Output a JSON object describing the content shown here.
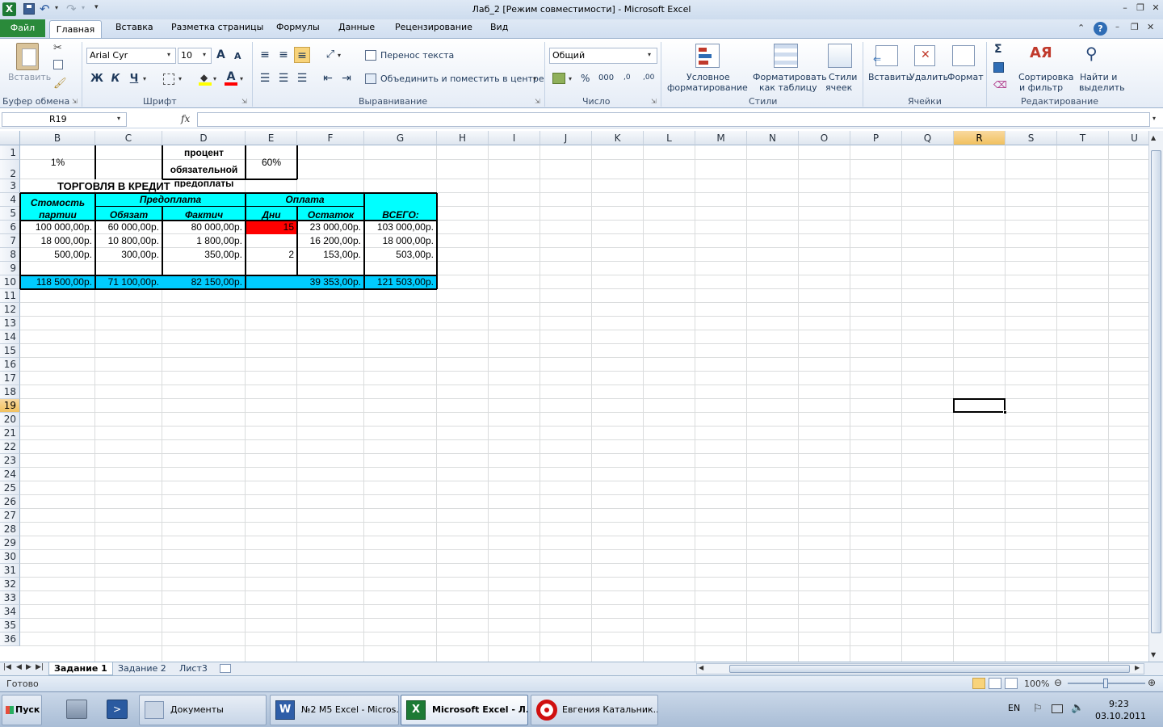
{
  "window": {
    "title": "Лаб_2  [Режим совместимости]  -  Microsoft Excel"
  },
  "quick_access": {
    "save_icon": "save-icon",
    "undo_icon": "undo-icon",
    "redo_icon": "redo-icon"
  },
  "tabs": [
    {
      "label": "Файл"
    },
    {
      "label": "Главная"
    },
    {
      "label": "Вставка"
    },
    {
      "label": "Разметка страницы"
    },
    {
      "label": "Формулы"
    },
    {
      "label": "Данные"
    },
    {
      "label": "Рецензирование"
    },
    {
      "label": "Вид"
    }
  ],
  "ribbon": {
    "clipboard": {
      "name": "Буфер обмена",
      "paste": "Вставить"
    },
    "font": {
      "name": "Шрифт",
      "family": "Arial Cyr",
      "size": "10",
      "bold": "Ж",
      "italic": "К",
      "underline": "Ч",
      "grow": "A",
      "shrink": "A",
      "color_letter": "A"
    },
    "alignment": {
      "name": "Выравнивание",
      "wrap": "Перенос текста",
      "merge": "Объединить и поместить в центре"
    },
    "number": {
      "name": "Число",
      "format": "Общий",
      "percent": "%",
      "thousands": "000",
      "inc_dec": ",0",
      "dec_dec": ",00"
    },
    "styles": {
      "name": "Стили",
      "conditional_1": "Условное",
      "conditional_2": "форматирование",
      "table_1": "Форматировать",
      "table_2": "как таблицу",
      "cell_1": "Стили",
      "cell_2": "ячеек"
    },
    "cells": {
      "name": "Ячейки",
      "insert": "Вставить",
      "delete": "Удалить",
      "format": "Формат"
    },
    "editing": {
      "name": "Редактирование",
      "sort_1": "Сортировка",
      "sort_2": "и фильтр",
      "find_1": "Найти и",
      "find_2": "выделить",
      "sigma": "Σ"
    }
  },
  "formula_bar": {
    "name_box": "R19",
    "fx": "fx",
    "content": ""
  },
  "columns": [
    "B",
    "C",
    "D",
    "E",
    "F",
    "G",
    "H",
    "I",
    "J",
    "K",
    "L",
    "M",
    "N",
    "O",
    "P",
    "Q",
    "R",
    "S",
    "T",
    "U"
  ],
  "rows": [
    "1",
    "2",
    "3",
    "4",
    "5",
    "6",
    "7",
    "8",
    "9",
    "10",
    "11",
    "12",
    "13",
    "14",
    "15",
    "16",
    "17",
    "18",
    "19",
    "20",
    "21",
    "22",
    "23",
    "24",
    "25",
    "26",
    "27",
    "28",
    "29",
    "30",
    "31",
    "32",
    "33",
    "34",
    "35",
    "36"
  ],
  "selected": {
    "column": "R",
    "row": "19"
  },
  "sheet": {
    "b2": "1%",
    "d1": "процент",
    "d1b": "обязательной",
    "d2": "предоплаты",
    "e2": "60%",
    "title": "ТОРГОВЛЯ В КРЕДИТ",
    "hdr_cost_1": "Стомость",
    "hdr_cost_2": "партии",
    "hdr_prepay": "Предоплата",
    "hdr_oblig": "Обязат",
    "hdr_fact": "Фактич",
    "hdr_payment": "Оплата",
    "hdr_days": "Дни",
    "hdr_rest": "Остаток",
    "hdr_total": "ВСЕГО:",
    "data": [
      {
        "b": "100 000,00р.",
        "c": "60 000,00р.",
        "d": "80 000,00р.",
        "e": "15",
        "f": "23 000,00р.",
        "g": "103 000,00р."
      },
      {
        "b": "18 000,00р.",
        "c": "10 800,00р.",
        "d": "1 800,00р.",
        "e": "",
        "f": "16 200,00р.",
        "g": "18 000,00р."
      },
      {
        "b": "500,00р.",
        "c": "300,00р.",
        "d": "350,00р.",
        "e": "2",
        "f": "153,00р.",
        "g": "503,00р."
      }
    ],
    "totals": {
      "b": "118 500,00р.",
      "c": "71 100,00р.",
      "d": "82 150,00р.",
      "f": "39 353,00р.",
      "g": "121 503,00р."
    }
  },
  "sheet_tabs": [
    "Задание 1",
    "Задание 2",
    "Лист3"
  ],
  "status": {
    "ready": "Готово",
    "zoom": "100%"
  },
  "taskbar": {
    "start": "Пуск",
    "items": [
      "Документы",
      "№2 М5 Excel - Micros...",
      "Microsoft Excel - Л...",
      "Евгения Катальник..."
    ],
    "lang": "EN",
    "time": "9:23",
    "date": "03.10.2011"
  },
  "colors": {
    "header_fill": "#00ffff",
    "total_fill": "#00ccff",
    "alert_fill": "#ff0000",
    "file_tab": "#2a8a3a",
    "selection": "#f1c15f"
  }
}
